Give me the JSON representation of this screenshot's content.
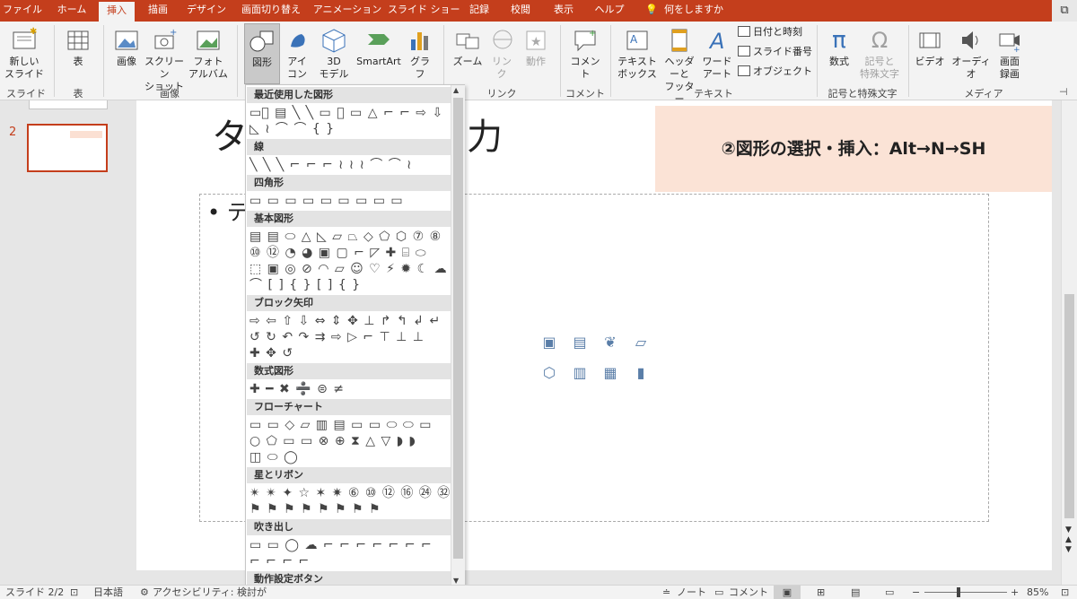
{
  "menubar": {
    "tabs": [
      "ファイル",
      "ホーム",
      "挿入",
      "描画",
      "デザイン",
      "画面切り替え",
      "アニメーション",
      "スライド ショー",
      "記録",
      "校閲",
      "表示",
      "ヘルプ"
    ],
    "active_tab": "挿入",
    "tellme": "何をしますか"
  },
  "ribbon": {
    "new_slide": "新しい\nスライド",
    "table": "表",
    "image": "画像",
    "screenshot": "スクリーン\nショット",
    "photo_album": "フォト\nアルバム",
    "shapes": "図形",
    "icons": "アイ\nコン",
    "models3d": "3D\nモデル",
    "smartart": "SmartArt",
    "chart": "グラフ",
    "zoom": "ズーム",
    "link": "リン\nク",
    "action": "動作",
    "comment": "コメント",
    "textbox": "テキスト\nボックス",
    "header_footer": "ヘッダーと\nフッター",
    "wordart": "ワード\nアート",
    "date_time": "日付と時刻",
    "slide_number": "スライド番号",
    "object": "オブジェクト",
    "equation": "数式",
    "symbol": "記号と\n特殊文字",
    "video": "ビデオ",
    "audio": "オーディオ",
    "screen_record": "画面\n録画",
    "groups": {
      "slide": "スライド",
      "table": "表",
      "image": "画像",
      "link": "リンク",
      "comment": "コメント",
      "text": "テキスト",
      "symbols": "記号と特殊文字",
      "media": "メディア"
    }
  },
  "thumbnail": {
    "number": "2"
  },
  "slide": {
    "title_partial_left": "タ",
    "title_partial_right": "力",
    "bullet_partial": "• テ",
    "callout": "②図形の選択・挿入：Alt→N→SH"
  },
  "dropdown": {
    "categories": [
      "最近使用した図形",
      "線",
      "四角形",
      "基本図形",
      "ブロック矢印",
      "数式図形",
      "フローチャート",
      "星とリボン",
      "吹き出し",
      "動作設定ボタン"
    ],
    "rows": {
      "recent_1": "▭⃞ ▤ ╲ ╲ ▭ ⬭ ▭ △ ⌐ ⌐ ⇨ ⇩",
      "recent_2": "◺ ≀ ⌒ ⌒ { }",
      "lines": "╲ ╲ ╲ ⌐ ⌐ ⌐ ≀ ≀ ≀ ⌒ ⌒ ≀",
      "rects": "▭ ▭ ▭ ▭ ▭ ▭ ▭ ▭ ▭",
      "basic_1": "▤ ▤ ⬭ △ ◺ ▱ ⏢ ◇ ⬠ ⬡ ⑦ ⑧",
      "basic_2": "⑩ ⑫ ◔ ◕ ▣ ▢ ⌐ ◸ ✚ ⌸ ⬭",
      "basic_3": "⬚ ▣ ◎ ⊘ ◠ ▱ ☺ ♡ ⚡ ✹ ☾ ☁",
      "basic_4": "⌒ [ ] { } [ ] { }",
      "arrows_1": "⇨ ⇦ ⇧ ⇩ ⇔ ⇕ ✥ ⊥ ↱ ↰ ↲ ↵",
      "arrows_2": "↺ ↻ ↶ ↷ ⇉ ⇨ ▷ ⌐ ⊤ ⊥ ⊥",
      "arrows_3": "✚ ✥ ↺",
      "math": "✚ ━ ✖ ➗ ⊜ ≠",
      "flow_1": "▭ ▭ ◇ ▱ ▥ ▤ ▭ ▭ ⬭ ⬭ ▭",
      "flow_2": "○ ⬠ ▭ ▭ ⊗ ⊕ ⧗ △ ▽ ◗ ◗",
      "flow_3": "◫ ⬭ ◯",
      "stars_1": "✴ ✴ ✦ ☆ ✶ ✷ ⑥ ⑩ ⑫ ⑯ ㉔ ㉜",
      "stars_2": "⚑ ⚑ ⚑ ⚑ ⚑ ⚑ ⚑ ⚑",
      "callouts_1": "▭ ▭ ◯ ☁ ⌐ ⌐ ⌐ ⌐ ⌐ ⌐ ⌐",
      "callouts_2": "⌐ ⌐ ⌐ ⌐"
    }
  },
  "status": {
    "slide": "スライド 2/2",
    "lang": "日本語",
    "accessibility": "アクセシビリティ: 検討が",
    "notes": "ノート",
    "comments": "コメント",
    "zoom": "85%"
  }
}
